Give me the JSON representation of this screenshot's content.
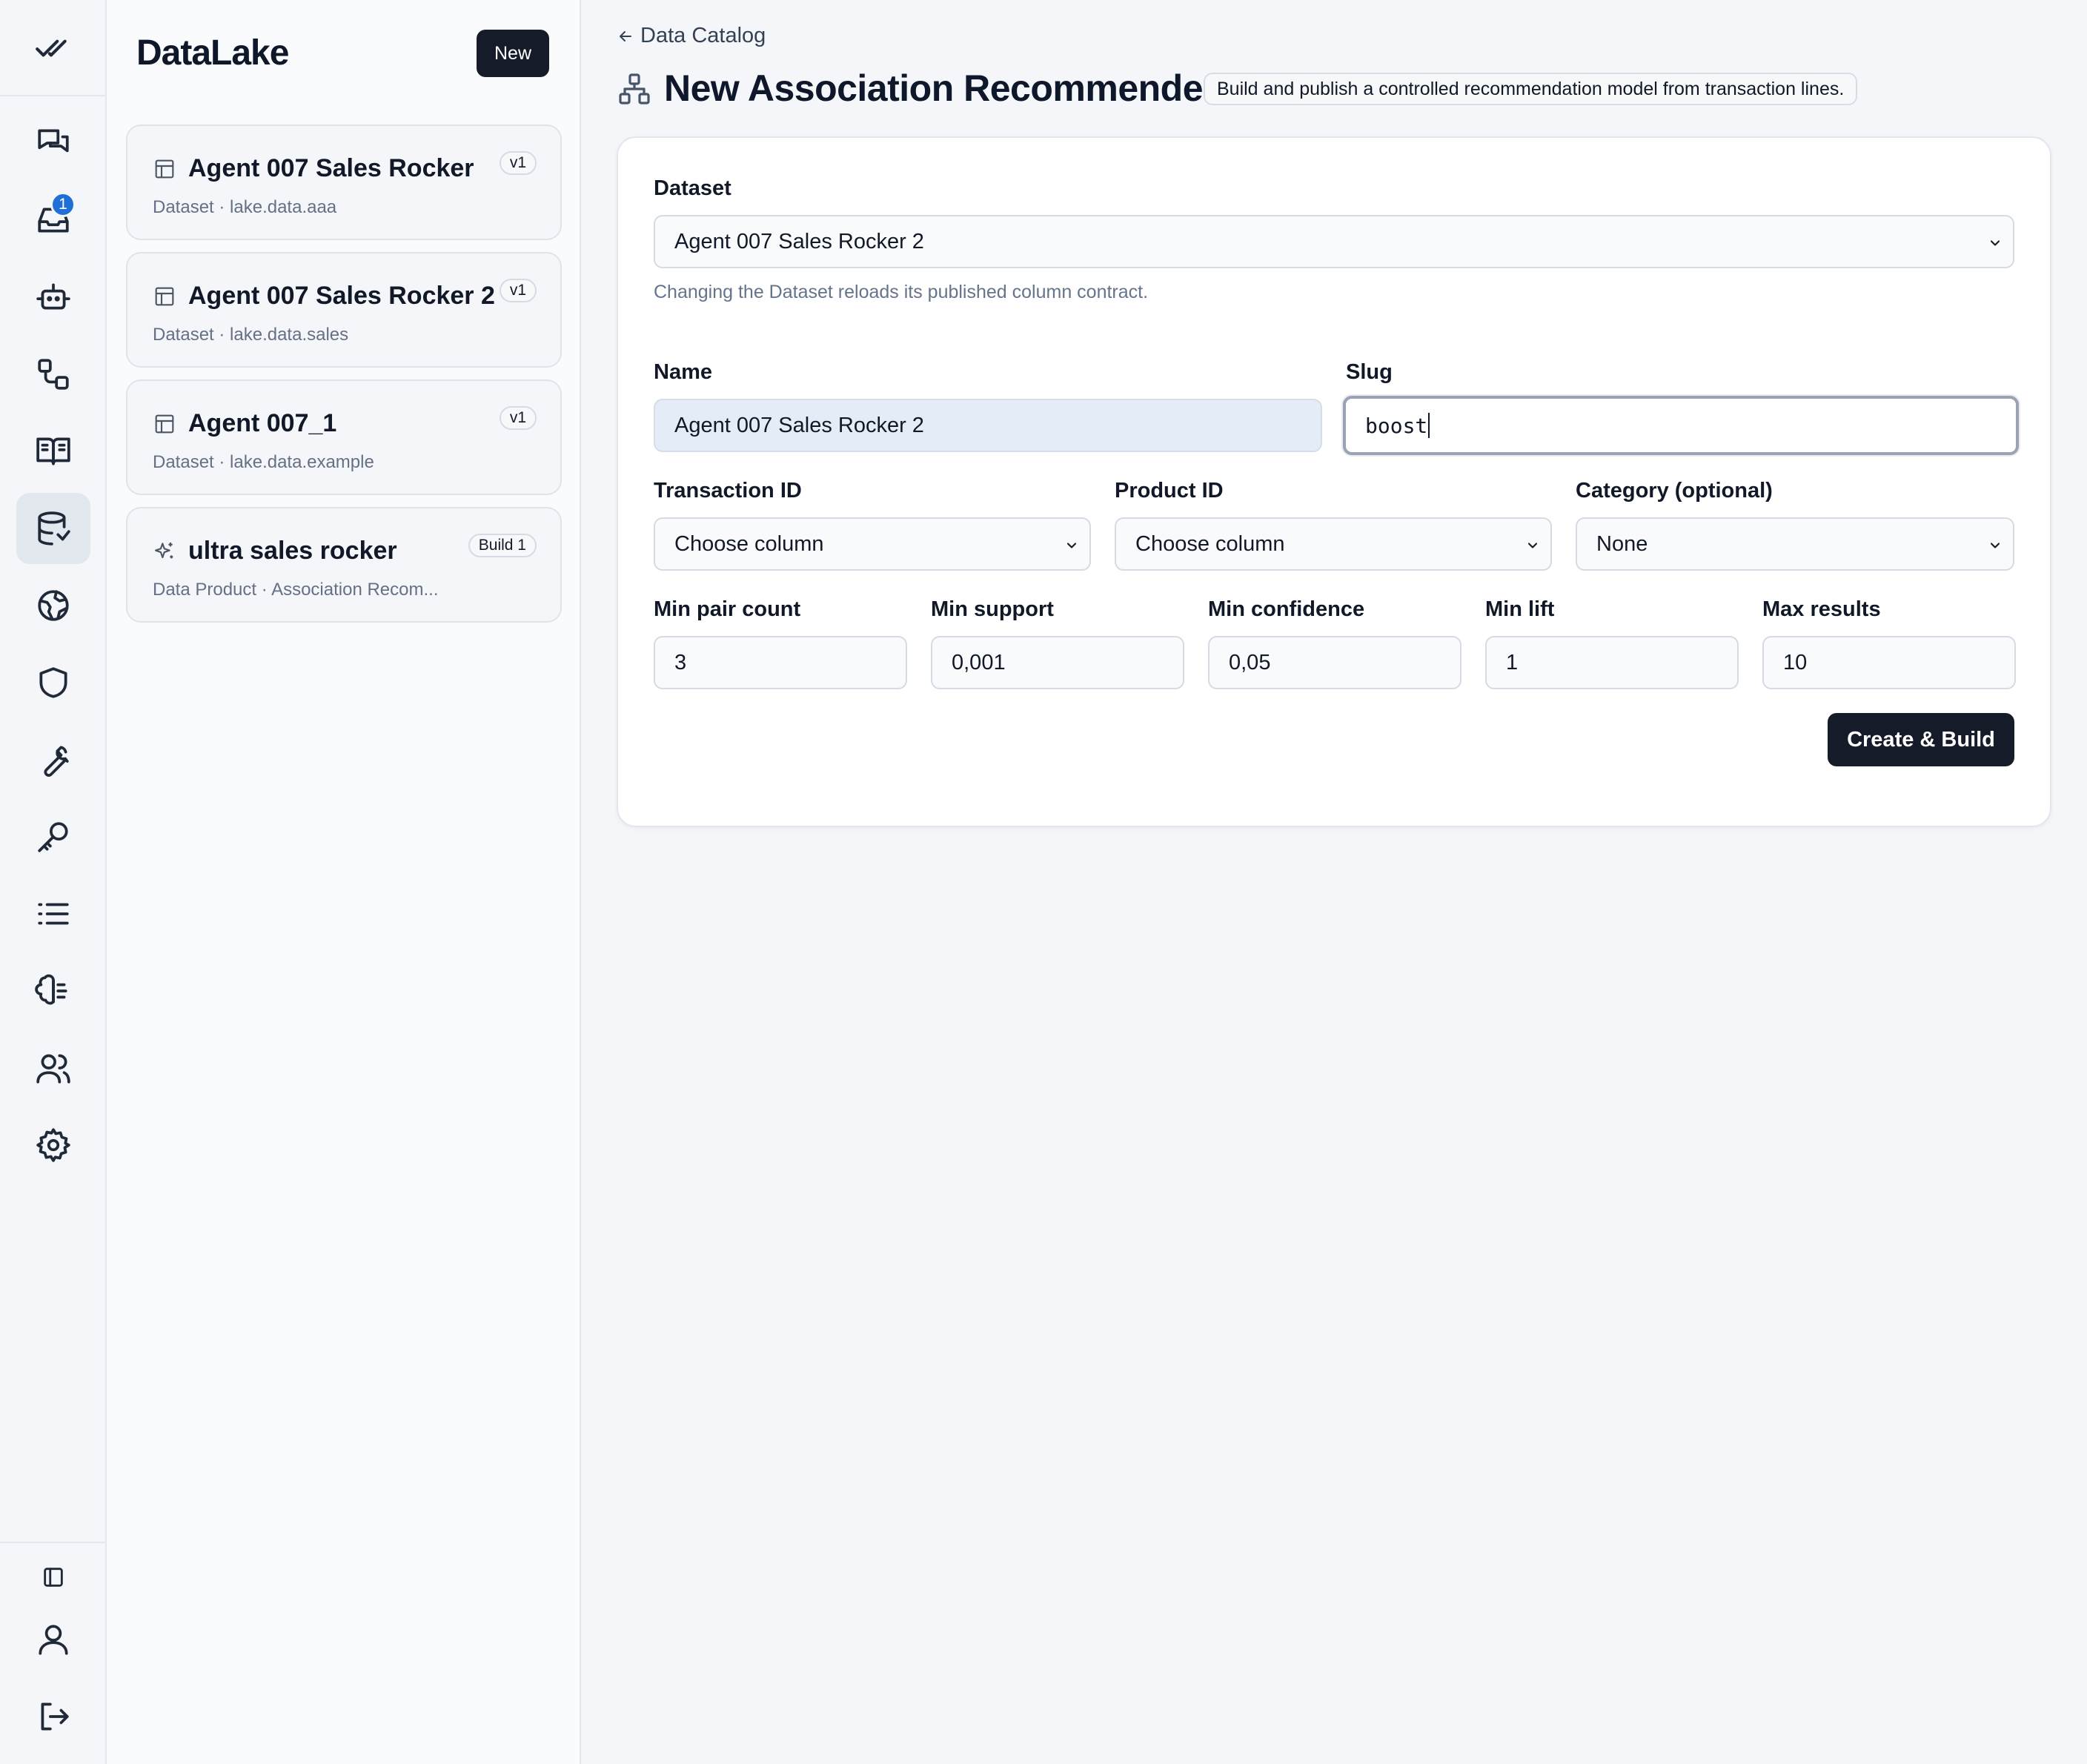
{
  "app": {
    "brand": "DataLake",
    "new_label": "New",
    "inbox_badge": "1"
  },
  "rail": {
    "icons": [
      "check-double-icon",
      "chat-icon",
      "inbox-icon",
      "bot-icon",
      "workflow-icon",
      "book-icon",
      "database-icon",
      "globe-icon",
      "shield-icon",
      "wrench-icon",
      "key-icon",
      "list-icon",
      "brain-icon",
      "users-icon",
      "gear-icon",
      "sidebar-toggle-icon",
      "user-icon",
      "logout-icon"
    ],
    "active": "database-icon"
  },
  "catalog": {
    "items": [
      {
        "title": "Agent 007 Sales Rocker",
        "subtitle": "Dataset · lake.data.aaa",
        "tag": "v1",
        "icon": "table-icon"
      },
      {
        "title": "Agent 007 Sales Rocker 2",
        "subtitle": "Dataset · lake.data.sales",
        "tag": "v1",
        "icon": "table-icon"
      },
      {
        "title": "Agent 007_1",
        "subtitle": "Dataset · lake.data.example",
        "tag": "v1",
        "icon": "table-icon"
      },
      {
        "title": "ultra sales rocker",
        "subtitle": "Data Product · Association Recom...",
        "tag": "Build 1",
        "icon": "sparkle-icon"
      }
    ]
  },
  "page": {
    "back_label": "Data Catalog",
    "title": "New Association Recommender",
    "description": "Build and publish a controlled recommendation model from transaction lines."
  },
  "form": {
    "dataset_label": "Dataset",
    "dataset_value": "Agent 007 Sales Rocker 2",
    "dataset_hint": "Changing the Dataset reloads its published column contract.",
    "name_label": "Name",
    "name_value": "Agent 007 Sales Rocker 2",
    "slug_label": "Slug",
    "slug_value": "boost",
    "transaction_label": "Transaction ID",
    "transaction_value": "Choose column",
    "product_label": "Product ID",
    "product_value": "Choose column",
    "category_label": "Category (optional)",
    "category_value": "None",
    "min_pair_label": "Min pair count",
    "min_pair_value": "3",
    "min_support_label": "Min support",
    "min_support_value": "0,001",
    "min_conf_label": "Min confidence",
    "min_conf_value": "0,05",
    "min_lift_label": "Min lift",
    "min_lift_value": "1",
    "max_results_label": "Max results",
    "max_results_value": "10",
    "submit_label": "Create & Build"
  },
  "colors": {
    "accent_dark": "#151b28",
    "badge_blue": "#1f6fd6",
    "name_field_bg": "#e4ecf8"
  }
}
